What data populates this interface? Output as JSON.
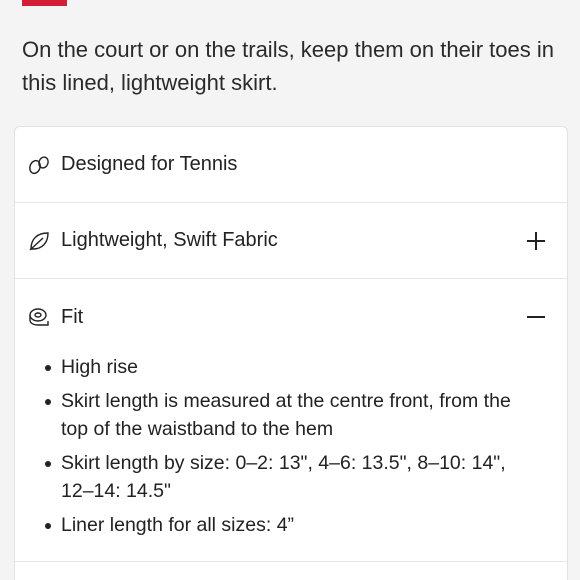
{
  "description": "On the court or on the trails, keep them on their toes in this lined, lightweight skirt.",
  "accordion": {
    "items": [
      {
        "label": "Designed for Tennis",
        "icon": "tennis-balls-icon"
      },
      {
        "label": "Lightweight, Swift Fabric",
        "icon": "leaf-icon",
        "toggle": "+"
      },
      {
        "label": "Fit",
        "icon": "tape-measure-icon",
        "toggle": "−"
      }
    ],
    "fit_details": [
      "High rise",
      "Skirt length is measured at the centre front, from the top of the waistband to the hem",
      "Skirt length by size: 0–2: 13\", 4–6: 13.5\", 8–10: 14\", 12–14: 14.5\"",
      "Liner length for all sizes: 4”"
    ]
  },
  "colors": {
    "accent": "#d31f36",
    "text": "#222222",
    "background": "#f4f4f4",
    "card": "#ffffff"
  }
}
